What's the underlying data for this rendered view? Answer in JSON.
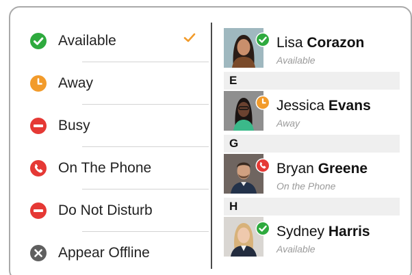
{
  "statuses": [
    {
      "label": "Available",
      "icon": "check-circle-icon",
      "color": "#2eaa3e",
      "selected": true
    },
    {
      "label": "Away",
      "icon": "clock-icon",
      "color": "#f29b2b"
    },
    {
      "label": "Busy",
      "icon": "minus-circle-icon",
      "color": "#e53935"
    },
    {
      "label": "On The Phone",
      "icon": "phone-icon",
      "color": "#e53935"
    },
    {
      "label": "Do Not Disturb",
      "icon": "minus-circle-icon",
      "color": "#e53935"
    },
    {
      "label": "Appear Offline",
      "icon": "x-circle-icon",
      "color": "#5f5f5f"
    }
  ],
  "selected_check_color": "#f29b2b",
  "contacts": {
    "headers": [
      "E",
      "G",
      "H"
    ],
    "items": [
      {
        "first": "Lisa",
        "last": "Corazon",
        "status": "Available",
        "presence": "available"
      },
      {
        "first": "Jessica",
        "last": "Evans",
        "status": "Away",
        "presence": "away"
      },
      {
        "first": "Bryan",
        "last": "Greene",
        "status": "On the Phone",
        "presence": "on-the-phone"
      },
      {
        "first": "Sydney",
        "last": "Harris",
        "status": "Available",
        "presence": "available"
      }
    ]
  }
}
